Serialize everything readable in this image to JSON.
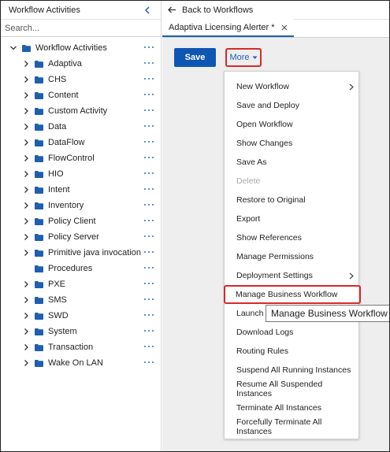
{
  "sidebar": {
    "title": "Workflow Activities",
    "search_placeholder": "Search...",
    "root": {
      "label": "Workflow Activities"
    },
    "items": [
      {
        "label": "Adaptiva",
        "expandable": true
      },
      {
        "label": "CHS",
        "expandable": true
      },
      {
        "label": "Content",
        "expandable": true
      },
      {
        "label": "Custom Activity",
        "expandable": true
      },
      {
        "label": "Data",
        "expandable": true
      },
      {
        "label": "DataFlow",
        "expandable": true
      },
      {
        "label": "FlowControl",
        "expandable": true
      },
      {
        "label": "HIO",
        "expandable": true
      },
      {
        "label": "Intent",
        "expandable": true
      },
      {
        "label": "Inventory",
        "expandable": true
      },
      {
        "label": "Policy Client",
        "expandable": true
      },
      {
        "label": "Policy Server",
        "expandable": true
      },
      {
        "label": "Primitive java invocation",
        "expandable": true
      },
      {
        "label": "Procedures",
        "expandable": false
      },
      {
        "label": "PXE",
        "expandable": true
      },
      {
        "label": "SMS",
        "expandable": true
      },
      {
        "label": "SWD",
        "expandable": true
      },
      {
        "label": "System",
        "expandable": true
      },
      {
        "label": "Transaction",
        "expandable": true
      },
      {
        "label": "Wake On LAN",
        "expandable": true
      }
    ]
  },
  "header": {
    "back_label": "Back to Workflows"
  },
  "tab": {
    "label": "Adaptiva Licensing Alerter *"
  },
  "toolbar": {
    "save_label": "Save",
    "more_label": "More"
  },
  "menu": {
    "items": [
      {
        "label": "New Workflow",
        "submenu": true
      },
      {
        "label": "Save and Deploy"
      },
      {
        "label": "Open Workflow"
      },
      {
        "label": "Show Changes"
      },
      {
        "label": "Save As"
      },
      {
        "label": "Delete",
        "disabled": true
      },
      {
        "label": "Restore to Original"
      },
      {
        "label": "Export"
      },
      {
        "label": "Show References"
      },
      {
        "label": "Manage Permissions"
      },
      {
        "label": "Deployment Settings",
        "submenu": true
      },
      {
        "label": "Manage Business Workflow",
        "highlighted": true
      },
      {
        "label": "Launch"
      },
      {
        "label": "Download Logs"
      },
      {
        "label": "Routing Rules"
      },
      {
        "label": "Suspend All Running Instances"
      },
      {
        "label": "Resume All Suspended Instances"
      },
      {
        "label": "Terminate All Instances"
      },
      {
        "label": "Forcefully Terminate All Instances"
      }
    ]
  },
  "tooltip": {
    "text": "Manage Business Workflow"
  },
  "colors": {
    "accent": "#0f56b3",
    "folder": "#1f5faf",
    "highlight": "#d42a2a",
    "disabled": "#a8a8a8"
  },
  "icons": {
    "folder": "folder-icon",
    "chevron": "chevron-right-icon",
    "more": "more-dots-icon",
    "back": "arrow-left-icon",
    "close": "close-icon",
    "collapse": "chevron-left-icon",
    "dropdown": "caret-down-icon"
  }
}
